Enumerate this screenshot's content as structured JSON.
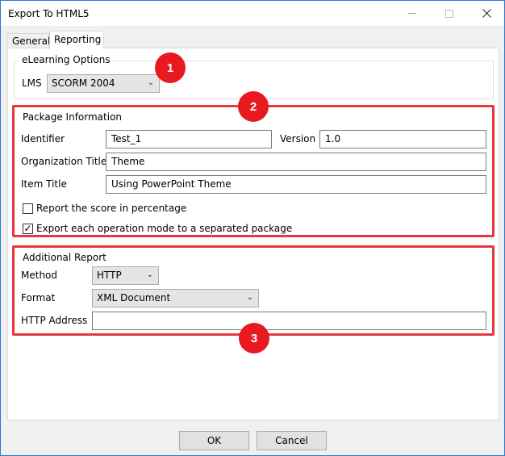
{
  "window": {
    "title": "Export To HTML5"
  },
  "tabs": [
    {
      "label": "General"
    },
    {
      "label": "Reporting"
    }
  ],
  "elearning": {
    "legend": "eLearning Options",
    "lms_label": "LMS",
    "lms_value": "SCORM 2004"
  },
  "package": {
    "legend": "Package Information",
    "identifier_label": "Identifier",
    "identifier_value": "Test_1",
    "version_label": "Version",
    "version_value": "1.0",
    "org_title_label": "Organization Title",
    "org_title_value": "Theme",
    "item_title_label": "Item Title",
    "item_title_value": "Using PowerPoint Theme",
    "report_score_label": "Report the score in percentage",
    "report_score_checked": false,
    "export_mode_label": "Export each operation mode to a separated package",
    "export_mode_checked": true
  },
  "additional": {
    "legend": "Additional Report",
    "method_label": "Method",
    "method_value": "HTTP",
    "format_label": "Format",
    "format_value": "XML Document",
    "http_address_label": "HTTP Address",
    "http_address_value": ""
  },
  "badges": [
    {
      "text": "1"
    },
    {
      "text": "2"
    },
    {
      "text": "3"
    }
  ],
  "buttons": {
    "ok": "OK",
    "cancel": "Cancel"
  },
  "colors": {
    "highlight": "#e8383d",
    "badge": "#e8191f",
    "window_border": "#2b79d6"
  }
}
